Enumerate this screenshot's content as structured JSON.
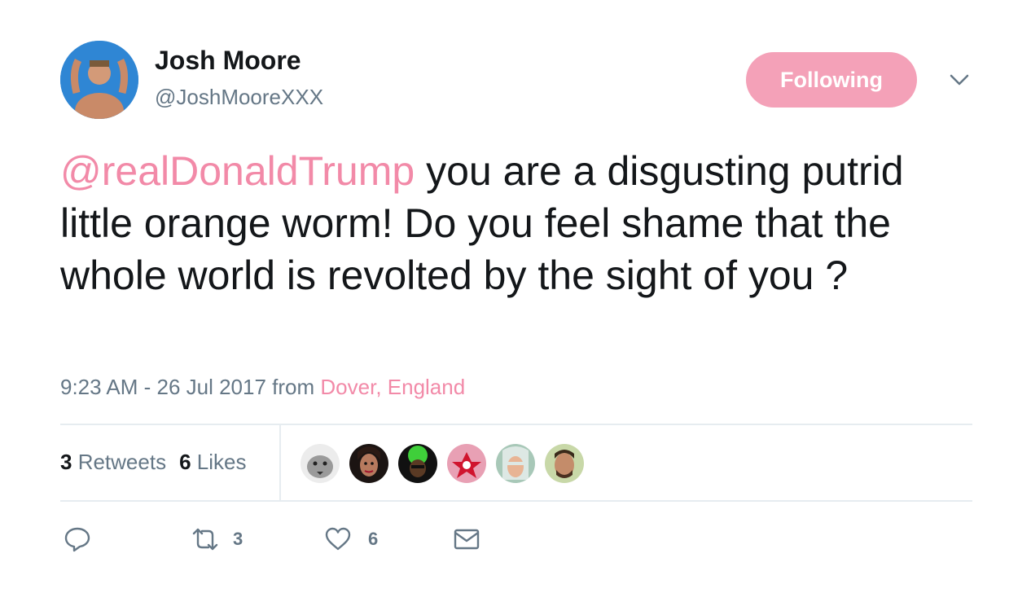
{
  "user": {
    "name": "Josh Moore",
    "handle": "@JoshMooreXXX",
    "follow_label": "Following"
  },
  "tweet": {
    "mention": "@realDonaldTrump",
    "body": " you are a disgusting putrid little orange worm! Do you feel shame that the whole world is revolted by the sight of you ?",
    "time": "9:23 AM - 26 Jul 2017",
    "from_word": " from ",
    "location": "Dover, England"
  },
  "stats": {
    "retweets_count": "3",
    "retweets_label": " Retweets",
    "likes_count": "6",
    "likes_label": " Likes"
  },
  "actions": {
    "reply_icon": "reply-icon",
    "retweet_icon": "retweet-icon",
    "retweet_count": "3",
    "like_icon": "heart-icon",
    "like_count": "6",
    "dm_icon": "envelope-icon"
  },
  "colors": {
    "accent": "#f28aa8",
    "follow_button": "#f4a1b8",
    "secondary_text": "#657786",
    "divider": "#e6ecf0"
  }
}
